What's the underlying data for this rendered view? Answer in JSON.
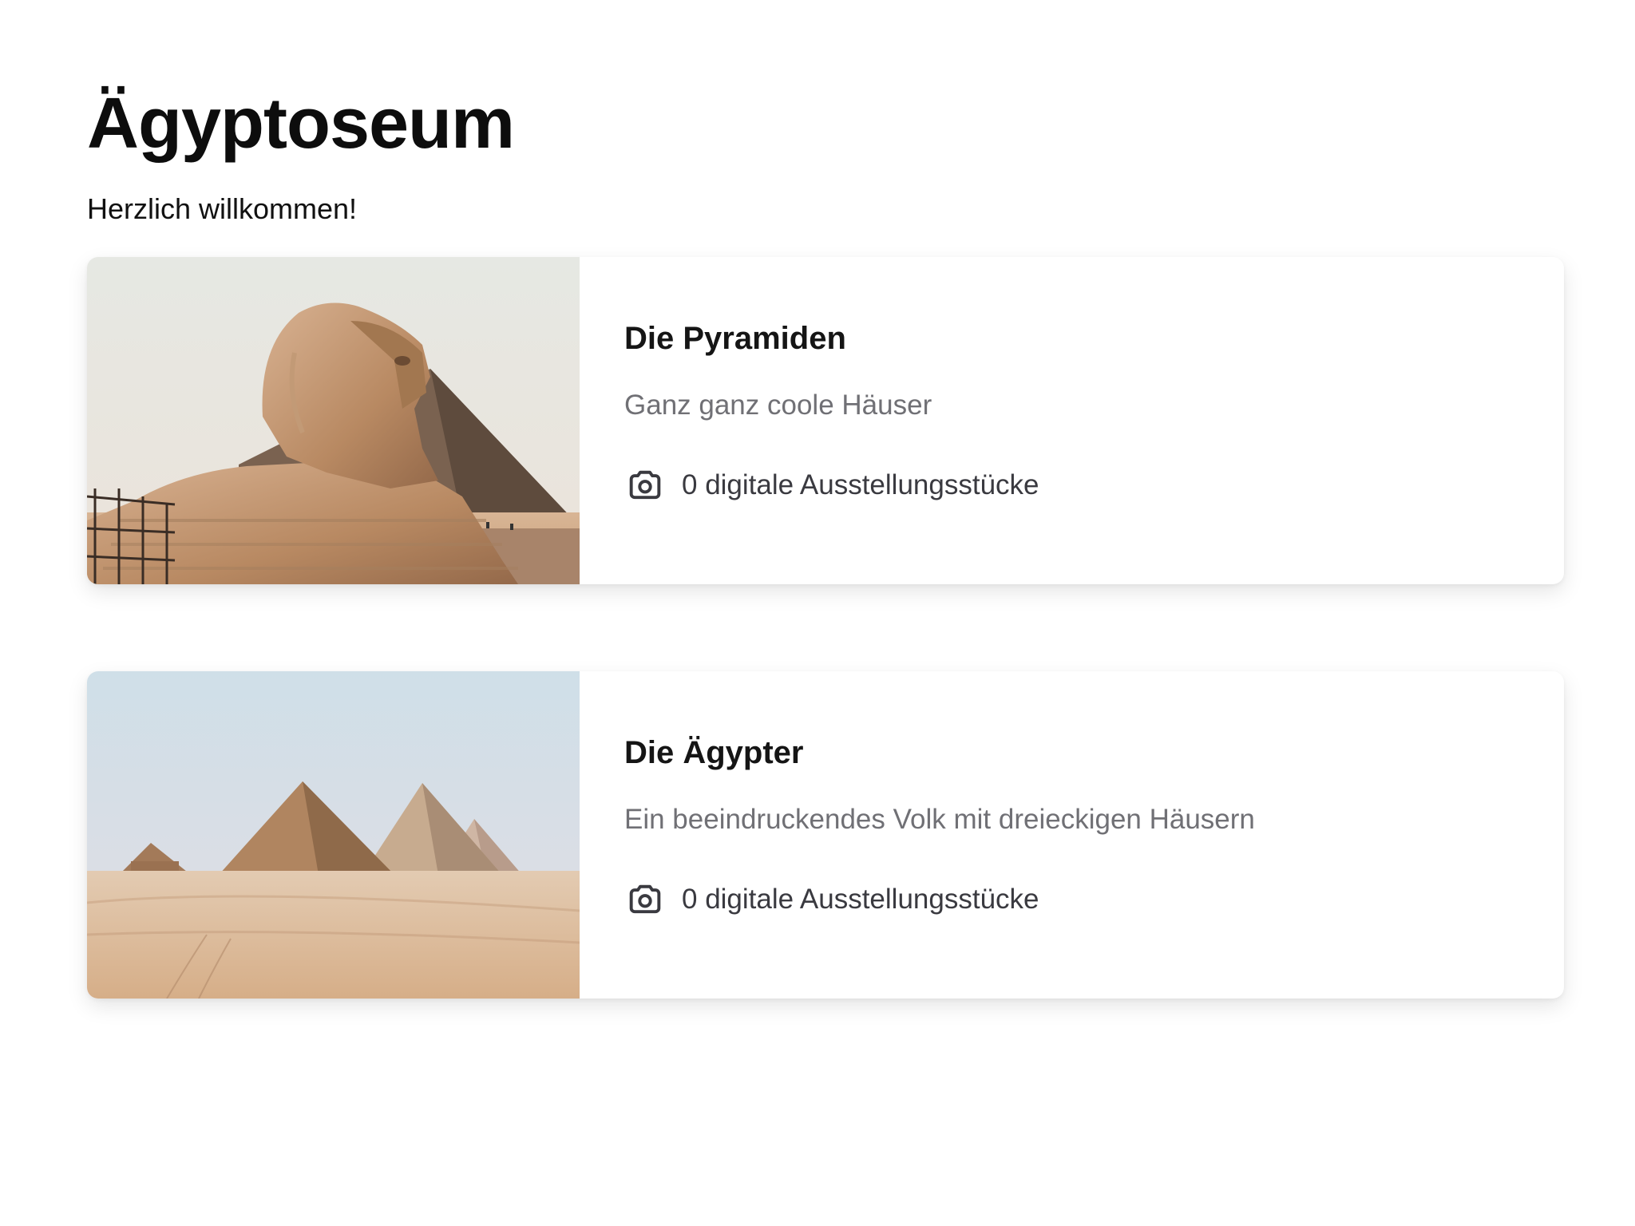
{
  "header": {
    "title": "Ägyptoseum",
    "welcome": "Herzlich willkommen!"
  },
  "cards": [
    {
      "title": "Die Pyramiden",
      "subtitle": "Ganz ganz coole Häuser",
      "exhibit_count": "0 digitale Ausstellungsstücke",
      "image": "sphinx-photo",
      "icon": "camera-icon"
    },
    {
      "title": "Die Ägypter",
      "subtitle": "Ein beeindruckendes Volk mit dreieckigen Häusern",
      "exhibit_count": "0 digitale Ausstellungsstücke",
      "image": "pyramids-photo",
      "icon": "camera-icon"
    }
  ],
  "colors": {
    "background": "#ffffff",
    "text": "#111111",
    "subtitle": "#707075",
    "meta": "#3a3a40"
  }
}
